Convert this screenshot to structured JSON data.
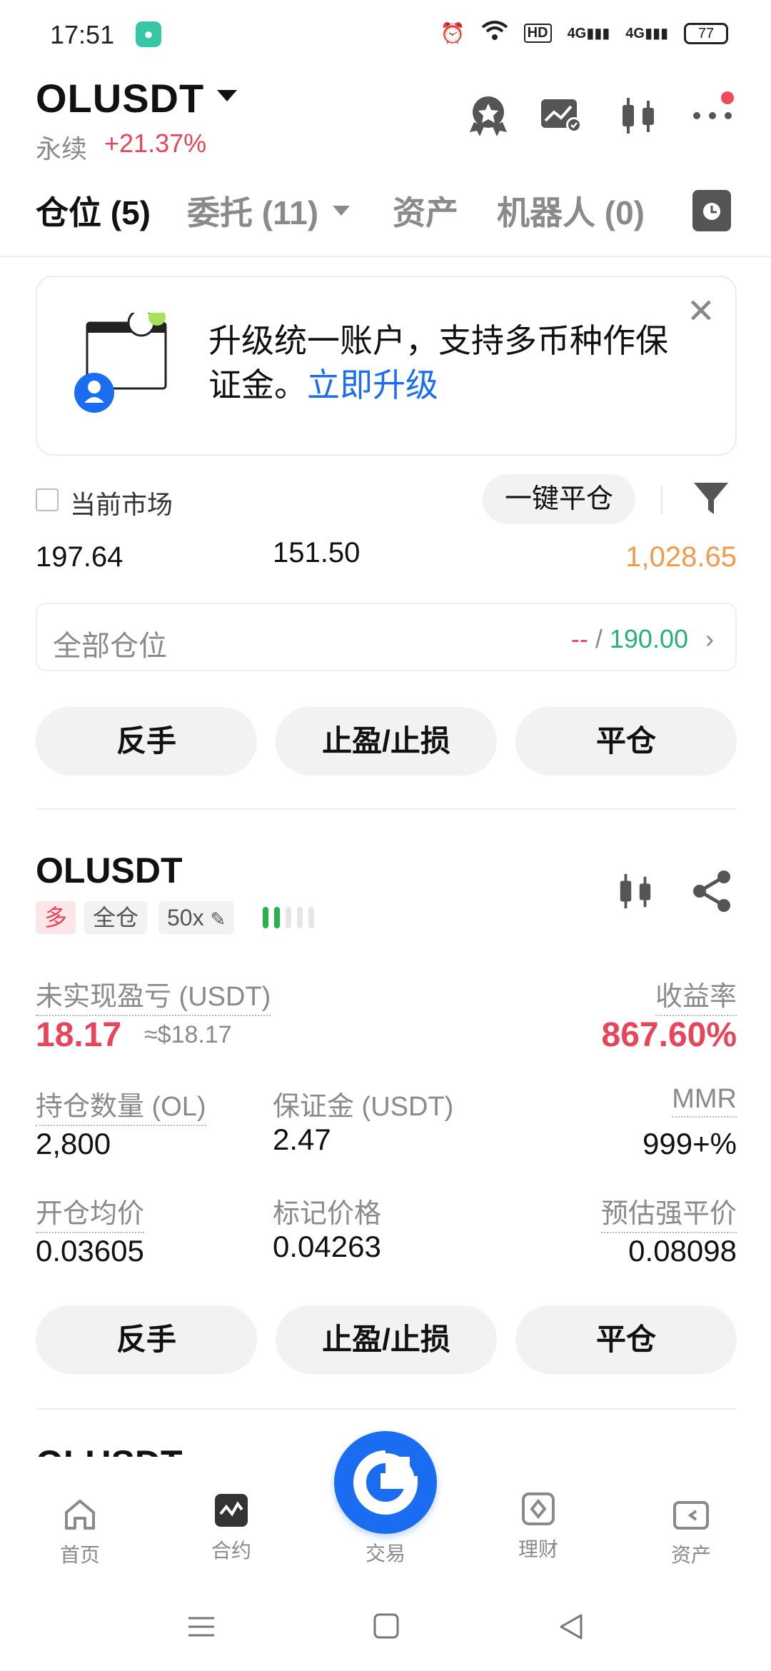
{
  "status_bar": {
    "time": "17:51",
    "app_badge": "●",
    "hd_label": "HD",
    "signal_1": "4G",
    "signal_2": "4G",
    "battery": "77"
  },
  "header": {
    "symbol": "OLUSDT",
    "type": "永续",
    "change": "+21.37%"
  },
  "tabs": [
    {
      "label": "仓位 (5)"
    },
    {
      "label": "委托 (11)"
    },
    {
      "label": "资产"
    },
    {
      "label": "机器人 (0)"
    }
  ],
  "promo": {
    "text": "升级统一账户，支持多币种作保证金。",
    "link": "立即升级"
  },
  "filters": {
    "current_market": "当前市场",
    "close_all": "一键平仓"
  },
  "summary": {
    "value1": "197.64",
    "value2": "151.50",
    "value3": "1,028.65"
  },
  "all_positions": {
    "label": "全部仓位",
    "left_value": "--",
    "separator": "/",
    "right_value": "190.00"
  },
  "actions": {
    "reverse": "反手",
    "tpsl": "止盈/止损",
    "close": "平仓"
  },
  "position": {
    "symbol": "OLUSDT",
    "side": "多",
    "margin_mode": "全仓",
    "leverage": "50x",
    "unrealized_label": "未实现盈亏 (USDT)",
    "unrealized_value": "18.17",
    "unrealized_usd": "≈$18.17",
    "roi_label": "收益率",
    "roi_value": "867.60%",
    "qty_label": "持仓数量 (OL)",
    "qty_value": "2,800",
    "margin_label": "保证金 (USDT)",
    "margin_value": "2.47",
    "mmr_label": "MMR",
    "mmr_value": "999+%",
    "entry_label": "开仓均价",
    "entry_value": "0.03605",
    "mark_label": "标记价格",
    "mark_value": "0.04263",
    "liq_label": "预估强平价",
    "liq_value": "0.08098"
  },
  "next_position_symbol": "OLUSDT",
  "bottom_nav": [
    {
      "label": "首页"
    },
    {
      "label": "合约"
    },
    {
      "label": "交易"
    },
    {
      "label": "理财"
    },
    {
      "label": "资产"
    }
  ]
}
